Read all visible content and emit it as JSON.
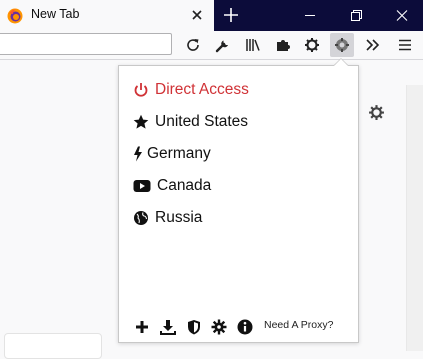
{
  "tab": {
    "title": "New Tab",
    "logo": "firefox-logo-icon"
  },
  "window_controls": [
    "minimize-icon",
    "maximize-icon",
    "close-icon"
  ],
  "toolbar": {
    "url_value": "",
    "icons": [
      "reload-icon",
      "wrench-icon",
      "library-icon",
      "extensions-icon",
      "settings-gear-icon",
      "proxy-extension-icon",
      "overflow-chevron-icon",
      "hamburger-menu-icon"
    ]
  },
  "popup": {
    "items": [
      {
        "label": "Direct Access",
        "icon": "power-icon",
        "color": "#d03236"
      },
      {
        "label": "United States",
        "icon": "star-icon"
      },
      {
        "label": "Germany",
        "icon": "lightning-icon"
      },
      {
        "label": "Canada",
        "icon": "youtube-play-icon"
      },
      {
        "label": "Russia",
        "icon": "globe-icon"
      }
    ],
    "footer": {
      "icons": [
        "add-icon",
        "import-icon",
        "shield-icon",
        "options-gear-icon",
        "info-icon"
      ],
      "link": "Need A Proxy?"
    }
  },
  "colors": {
    "titlebar": "#0c0c3a",
    "accent_red": "#d03236",
    "toolbar_bg": "#f9f9fa"
  }
}
